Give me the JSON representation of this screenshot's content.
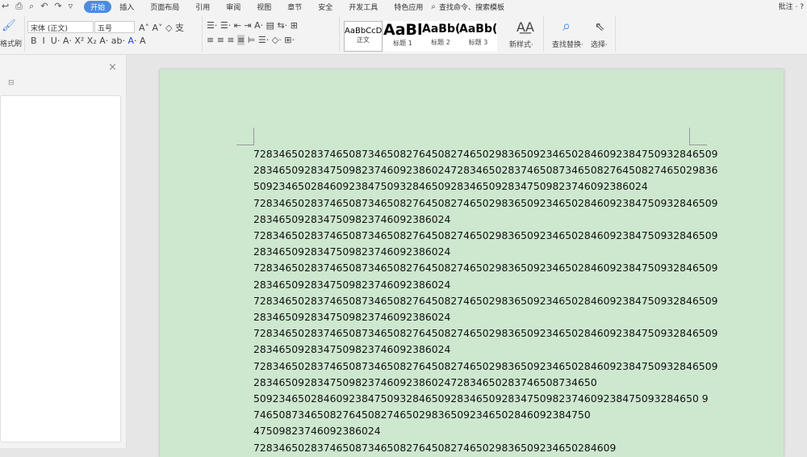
{
  "quick_access": [
    "↩",
    "⎙",
    "⌕",
    "↶",
    "↷",
    "▿"
  ],
  "menu": [
    "开始",
    "插入",
    "页面布局",
    "引用",
    "审阅",
    "视图",
    "章节",
    "安全",
    "开发工具",
    "特色应用"
  ],
  "search_command": "查找命令、搜索模板",
  "comment_label": "批注 ·",
  "help": "?",
  "ribbon": {
    "format_painter": "格式刷",
    "font_name": "宋体 (正文)",
    "font_size": "五号",
    "styles": [
      {
        "preview": "AaBbCcDd",
        "label": "正文"
      },
      {
        "preview": "AaBl",
        "label": "标题 1"
      },
      {
        "preview": "AaBb(",
        "label": "标题 2"
      },
      {
        "preview": "AaBb(",
        "label": "标题 3"
      }
    ],
    "new_style": "新样式·",
    "find_replace": "查找替换·",
    "select": "选择·"
  },
  "document": {
    "lines": [
      "7283465028374650873465082764508274650298365092346502846092384750932846509",
      "2834650928347509823746092386024728346502837465087346508276450827465029836",
      "50923465028460923847509328465092834650928347509823746092386024",
      "7283465028374650873465082764508274650298365092346502846092384750932846509",
      "2834650928347509823746092386024",
      "7283465028374650873465082764508274650298365092346502846092384750932846509",
      "2834650928347509823746092386024",
      "7283465028374650873465082764508274650298365092346502846092384750932846509",
      "2834650928347509823746092386024",
      "7283465028374650873465082764508274650298365092346502846092384750932846509",
      "2834650928347509823746092386024",
      "7283465028374650873465082764508274650298365092346502846092384750932846509",
      "2834650928347509823746092386024",
      "7283465028374650873465082764508274650298365092346502846092384750932846509",
      "283465092834750982374609238602472834650283746508734650",
      "5092346502846092384750932846509283465092834750982374609238475093284650 9",
      "74650873465082764508274650298365092346502846092384750",
      "47509823746092386024",
      "728346502837465087346508276450827465029836509234650284609"
    ]
  }
}
